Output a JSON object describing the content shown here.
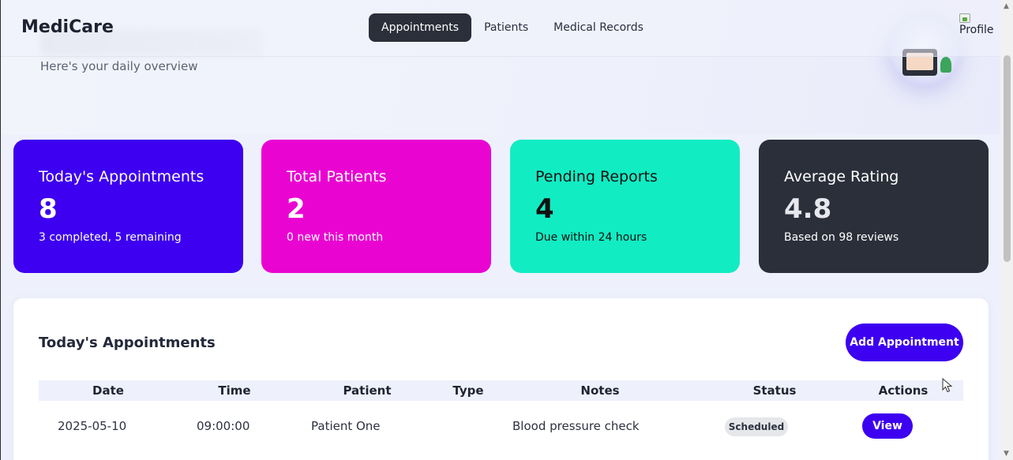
{
  "brand": "MediCare",
  "nav": {
    "items": [
      {
        "label": "Appointments",
        "active": true
      },
      {
        "label": "Patients",
        "active": false
      },
      {
        "label": "Medical Records",
        "active": false
      }
    ],
    "profile_alt": "Profile"
  },
  "hero": {
    "subtitle": "Here's your daily overview"
  },
  "stats": [
    {
      "title": "Today's Appointments",
      "value": "8",
      "sub": "3 completed, 5 remaining",
      "color": "#3d00f0"
    },
    {
      "title": "Total Patients",
      "value": "2",
      "sub": "0 new this month",
      "color": "#ea04d2"
    },
    {
      "title": "Pending Reports",
      "value": "4",
      "sub": "Due within 24 hours",
      "color": "#12ecc3"
    },
    {
      "title": "Average Rating",
      "value": "4.8",
      "sub": "Based on 98 reviews",
      "color": "#2b2f3a"
    }
  ],
  "appointments": {
    "title": "Today's Appointments",
    "add_label": "Add Appointment",
    "columns": [
      "Date",
      "Time",
      "Patient",
      "Type",
      "Notes",
      "Status",
      "Actions"
    ],
    "rows": [
      {
        "date": "2025-05-10",
        "time": "09:00:00",
        "patient": "Patient One",
        "type": "",
        "notes": "Blood pressure check",
        "status": "Scheduled",
        "action": "View"
      }
    ]
  },
  "colors": {
    "accent": "#3d00f0",
    "dark": "#2b2f3a"
  }
}
